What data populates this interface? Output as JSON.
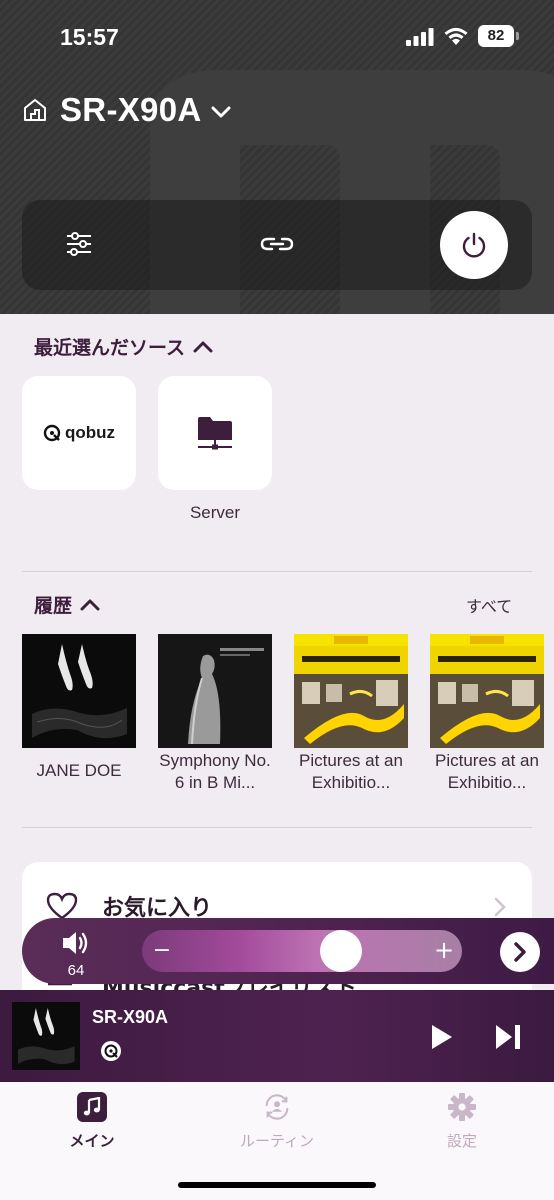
{
  "status_bar": {
    "time": "15:57",
    "battery_level": "82"
  },
  "header": {
    "device_name": "SR-X90A",
    "icons": [
      "home-icon",
      "chevron-down-icon",
      "equalizer-icon",
      "link-icon",
      "power-icon"
    ]
  },
  "recent_sources": {
    "title": "最近選んだソース",
    "items": [
      {
        "label": "",
        "logo_text": "qobuz",
        "icon": "qobuz-logo-icon"
      },
      {
        "label": "Server",
        "icon": "folder-server-icon"
      }
    ]
  },
  "history": {
    "title": "履歴",
    "see_all": "すべて",
    "items": [
      {
        "caption": "JANE DOE"
      },
      {
        "caption": "Symphony No. 6 in B Mi..."
      },
      {
        "caption": "Pictures at an Exhibitio..."
      },
      {
        "caption": "Pictures at an Exhibitio..."
      }
    ]
  },
  "favorites": {
    "label": "お気に入り",
    "second_label": "Musiccastプレイリスト"
  },
  "volume": {
    "value": "64",
    "level_fraction": 0.64,
    "minus_label": "−",
    "plus_label": "+"
  },
  "mini_player": {
    "device_name": "SR-X90A"
  },
  "tabs": [
    {
      "label": "メイン",
      "icon": "music-note-icon",
      "active": true
    },
    {
      "label": "ルーティン",
      "icon": "routine-icon",
      "active": false
    },
    {
      "label": "設定",
      "icon": "gear-icon",
      "active": false
    }
  ],
  "colors": {
    "accent": "#3d1f3d",
    "header_bg": "#373737",
    "bar_purple": "#4e2250"
  }
}
